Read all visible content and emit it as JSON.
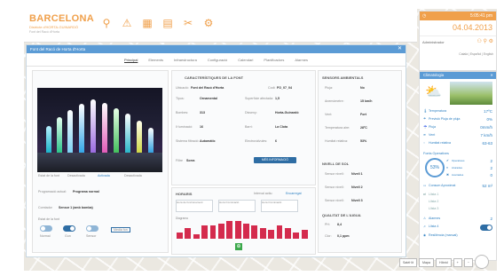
{
  "header": {
    "title": "BARCELONA",
    "subtitle": "Districte d'HORTA-GUINARDÓ",
    "subtitle2": "Font del Racó d'Horta",
    "icons": [
      "map-pin-icon",
      "warning-icon",
      "chart-icon",
      "document-icon",
      "tools-icon",
      "gear-icon"
    ]
  },
  "dialog": {
    "title": "Font del Racó de Horta d'Horta",
    "tabs": [
      "Principal",
      "Elements",
      "Infraestructura",
      "Configuració",
      "Calendari",
      "Planificadors",
      "Alarmes"
    ],
    "photo_options": [
      "Estat de la font",
      "Desactivada",
      "Activada",
      "Desactivada"
    ],
    "programacio_label": "Programació actual:",
    "programacio_value": "Programa normal",
    "comtador_label": "Comtador",
    "comtador_value": "Sensor 1 (amb bomba)",
    "estat_label": "Estat de la font",
    "toggles": [
      "Normal",
      "Gun",
      "Sensor"
    ],
    "toggle_values": [
      "off",
      "on",
      "off"
    ],
    "toggle_badge": "Media fon",
    "characteristics": {
      "title": "CARACTERÍSTIQUES DE LA FONT",
      "ubicacio_label": "Ubicació:",
      "ubicacio_value": "Font del Racó d'Horta",
      "codi_label": "Codi:",
      "codi_value": "FO_07_04",
      "rows": [
        {
          "l": "Tipus:",
          "v": "Ornamental",
          "l2": "Superfície afectada:",
          "v2": "1,5"
        },
        {
          "l": "Bombes:",
          "v": "313",
          "l2": "Disseny:",
          "v2": "Horta-Guinardó"
        },
        {
          "l": "Il·luminació:",
          "v": "16",
          "l2": "Barri:",
          "v2": "La Clota"
        },
        {
          "l": "Sistema filtració:",
          "v": "Automàtic",
          "l2": "Electrovàlvules:",
          "v2": "6"
        }
      ],
      "filtre_label": "Filtre",
      "filtre_value": "Sorra",
      "button": "MÉS INFORMACIÓ"
    },
    "horari": {
      "title": "HORARIS",
      "activity": "Interval actiu:",
      "activity_value": "Encarregat",
      "fields": [
        "Hora de funcionament",
        "Hora il·luminació",
        "Hora il·luminació"
      ],
      "chart_title": "Diagrama"
    },
    "ambient": {
      "title": "SENSORS AMBIENTALS",
      "rows": [
        {
          "l": "Pluja:",
          "v": "No"
        },
        {
          "l": "Anemòmetre:",
          "v": "15 km/h"
        },
        {
          "l": "Vent:",
          "v": "Fort"
        },
        {
          "l": "Temperatura aire:",
          "v": "28ºC"
        },
        {
          "l": "Humitat relativa:",
          "v": "53%"
        }
      ],
      "nivell_title": "NIVELL DE SOL",
      "nivell_rows": [
        {
          "l": "Sensor nivell:",
          "v": "Nivell 1"
        },
        {
          "l": "Sensor nivell:",
          "v": "Nivell 2"
        },
        {
          "l": "Sensor nivell:",
          "v": "Nivell 3"
        }
      ],
      "qualitat_title": "QUALITAT DE L'AIGUA",
      "qualitat_rows": [
        {
          "l": "PH:",
          "v": "8,4"
        },
        {
          "l": "Clor:",
          "v": "0,1 ppm"
        }
      ]
    }
  },
  "chart_data": {
    "type": "bar",
    "title": "Diagrama",
    "values": [
      3,
      5,
      2,
      6,
      6,
      7,
      8,
      8,
      7,
      6,
      5,
      4,
      6,
      5,
      3,
      4
    ],
    "ylim": [
      0,
      8
    ]
  },
  "status_box": {
    "time": "5:05:41 pm",
    "date": "04.04.2013",
    "user": "Administrador",
    "links": [
      "Català",
      "Español",
      "English"
    ]
  },
  "climate": {
    "title": "Climatologia",
    "rows": [
      {
        "l": "Temperatura",
        "v": "17ºC"
      },
      {
        "l": "Previsió Pluja de pluja",
        "v": "0%"
      },
      {
        "l": "Pluja",
        "v": "0mm/h"
      },
      {
        "l": "Vent",
        "v": "7 km/h"
      },
      {
        "l": "Humitat relativa",
        "v": "63-63"
      }
    ],
    "fonts_title": "Fonts Operatives",
    "percent": "53%",
    "counts": [
      {
        "l": "Operatives",
        "v": "2"
      },
      {
        "l": "Aturades",
        "v": "2"
      },
      {
        "l": "Averiades",
        "v": "0"
      }
    ],
    "consum_label": "Consum Aproximat",
    "consum_value": "52 m³",
    "lists": [
      "Llista 1",
      "Llista 2",
      "Llista 3"
    ],
    "alarms": [
      {
        "l": "Alarmes",
        "v": "2"
      },
      {
        "l": "Llista 4",
        "v": "2"
      }
    ],
    "toggle_label": "Resiliència (manual)"
  },
  "map_controls": [
    "Satèl·lit",
    "Mapa",
    "Híbrid",
    "+",
    "−"
  ],
  "colors": {
    "accent": "#f0a04b",
    "blue": "#5b9bd5",
    "bar": "#d42b4d"
  }
}
